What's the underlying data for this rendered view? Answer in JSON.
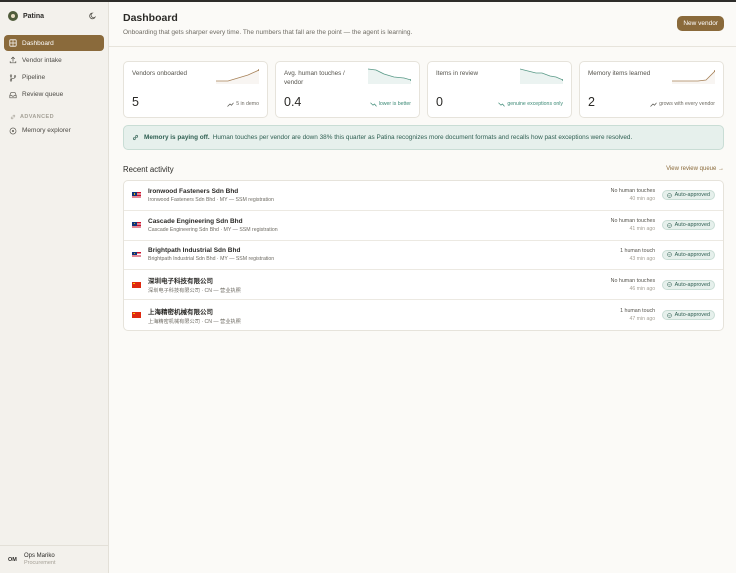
{
  "app": {
    "name": "Patina"
  },
  "sidebar": {
    "items": [
      {
        "label": "Dashboard",
        "icon": "grid-icon",
        "active": true
      },
      {
        "label": "Vendor intake",
        "icon": "upload-icon"
      },
      {
        "label": "Pipeline",
        "icon": "branch-icon"
      },
      {
        "label": "Review queue",
        "icon": "inbox-icon"
      }
    ],
    "section": "ADVANCED",
    "advanced_items": [
      {
        "label": "Memory explorer",
        "icon": "memory-icon"
      }
    ],
    "user": {
      "initials": "OM",
      "name": "Ops Mariko",
      "role": "Procurement"
    }
  },
  "header": {
    "title": "Dashboard",
    "subtitle": "Onboarding that gets sharper every time. The numbers that fall are the point — the agent is learning.",
    "new_vendor_label": "New vendor"
  },
  "stats": [
    {
      "label": "Vendors onboarded",
      "value": "5",
      "note": "5 in demo",
      "trend": "up"
    },
    {
      "label": "Avg. human touches / vendor",
      "value": "0.4",
      "note": "lower is better",
      "trend": "down"
    },
    {
      "label": "Items in review",
      "value": "0",
      "note": "genuine exceptions only",
      "trend": "down"
    },
    {
      "label": "Memory items learned",
      "value": "2",
      "note": "grows with every vendor",
      "trend": "up"
    }
  ],
  "banner": {
    "title": "Memory is paying off.",
    "text": "Human touches per vendor are down 38% this quarter as Patina recognizes more document formats and recalls how past exceptions were resolved."
  },
  "activity": {
    "title": "Recent activity",
    "view_all": "View review queue →",
    "rows": [
      {
        "flag": "MY",
        "name": "Ironwood Fasteners Sdn Bhd",
        "sub": "Ironwood Fasteners Sdn Bhd · MY — SSM registration",
        "touches": "No human touches",
        "time": "40 min ago",
        "status": "Auto-approved"
      },
      {
        "flag": "MY",
        "name": "Cascade Engineering Sdn Bhd",
        "sub": "Cascade Engineering Sdn Bhd · MY — SSM registration",
        "touches": "No human touches",
        "time": "41 min ago",
        "status": "Auto-approved"
      },
      {
        "flag": "MY",
        "name": "Brightpath Industrial Sdn Bhd",
        "sub": "Brightpath Industrial Sdn Bhd · MY — SSM registration",
        "touches": "1 human touch",
        "time": "43 min ago",
        "status": "Auto-approved"
      },
      {
        "flag": "CN",
        "name": "深圳电子科技有限公司",
        "sub": "深圳电子科技有限公司 · CN — 营业执照",
        "touches": "No human touches",
        "time": "46 min ago",
        "status": "Auto-approved"
      },
      {
        "flag": "CN",
        "name": "上海精密机械有限公司",
        "sub": "上海精密机械有限公司 · CN — 营业执照",
        "touches": "1 human touch",
        "time": "47 min ago",
        "status": "Auto-approved"
      }
    ]
  },
  "colors": {
    "accent": "#8a6a3b",
    "success": "#3d8a76",
    "banner_bg": "#e6f0ec"
  }
}
